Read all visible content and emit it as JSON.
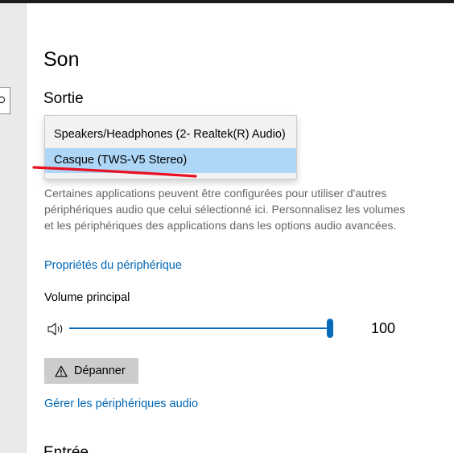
{
  "page": {
    "title": "Son"
  },
  "output": {
    "section_title": "Sortie",
    "dropdown": {
      "options": [
        "Speakers/Headphones (2- Realtek(R) Audio)",
        "Casque (TWS-V5 Stereo)"
      ],
      "selected_index": 1
    },
    "description": "Certaines applications peuvent être configurées pour utiliser d'autres périphériques audio que celui sélectionné ici. Personnalisez les volumes et les périphériques des applications dans les options audio avancées.",
    "device_properties_link": "Propriétés du périphérique",
    "volume": {
      "label": "Volume principal",
      "value": "100",
      "level": 1.0
    },
    "troubleshoot_label": "Dépanner",
    "manage_devices_link": "Gérer les périphériques audio"
  },
  "input": {
    "section_title_partial": "Entrée"
  },
  "colors": {
    "accent": "#0a6bbd",
    "link": "#0066b4",
    "selected_option": "#aed6f6",
    "annotation_red": "#e81123",
    "button_bg": "#cccccc"
  },
  "icons": {
    "search": "search-icon",
    "speaker": "speaker-volume-icon",
    "warning": "warning-icon"
  }
}
